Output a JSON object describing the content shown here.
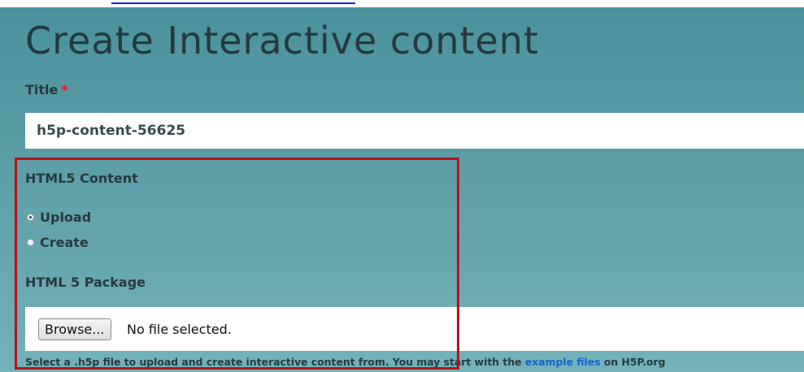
{
  "page": {
    "title": "Create Interactive content"
  },
  "form": {
    "title_label": "Title",
    "required_mark": "*",
    "title_value": "h5p-content-56625",
    "html5_label": "HTML5 Content",
    "radio_options": [
      {
        "label": "Upload",
        "checked": true
      },
      {
        "label": "Create",
        "checked": false
      }
    ],
    "package_label": "HTML 5 Package",
    "browse_label": "Browse...",
    "file_status": "No file selected.",
    "help_prefix": "Select a .h5p file to upload and create interactive content from. You may start with the ",
    "help_link": "example files",
    "help_suffix": " on H5P.org"
  },
  "colors": {
    "panel_top": "#4a919c",
    "panel_bottom": "#74b2bb",
    "highlight_border": "#b0141c",
    "required": "#e0141e",
    "link": "#1b63c6"
  }
}
